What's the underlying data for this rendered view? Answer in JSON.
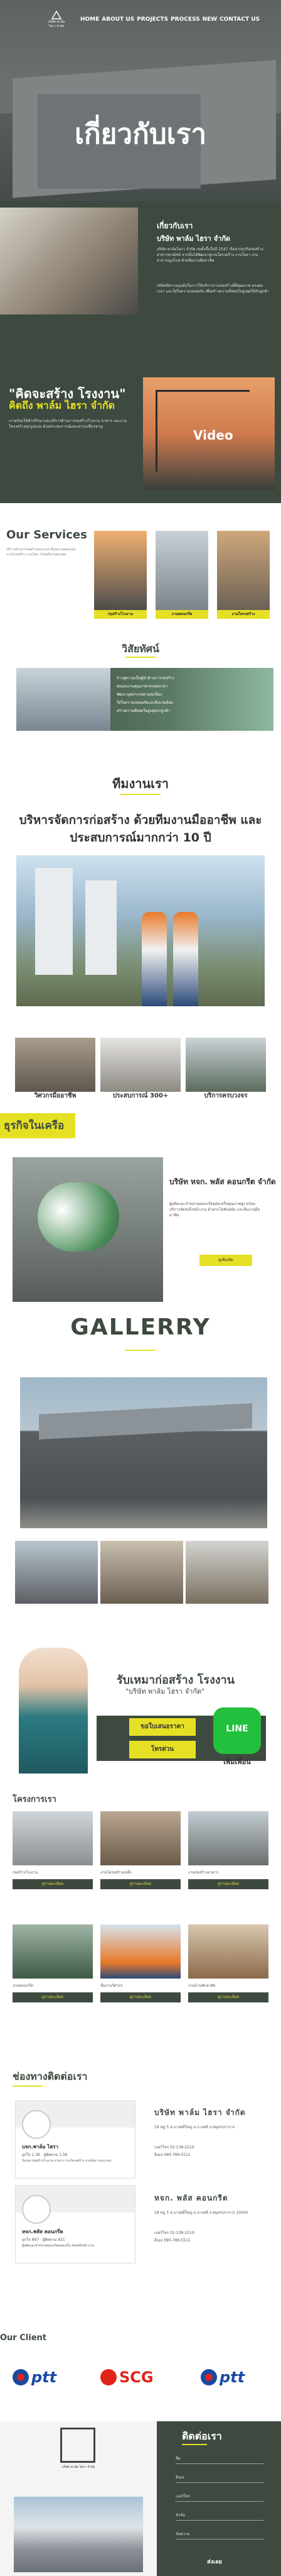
{
  "header": {
    "logo_line1": "บริษัท พาล์ม",
    "logo_line2": "ไฮรา จำกัด",
    "nav": [
      "HOME",
      "ABOUT US",
      "PROJECTS",
      "PROCESS",
      "NEW",
      "CONTACT US"
    ]
  },
  "hero": {
    "title": "เกี่ยวกับเรา"
  },
  "about": {
    "heading": "เกี่ยวกับเรา",
    "company": "บริษัท พาล์ม ไฮรา จำกัด",
    "para1": "บริษัท พาล์มไฮรา จำกัด ก่อตั้งขึ้นในปี 2547 เริ่มจากธุรกิจก่อสร้างอาคารพาณิชย์ จากนั้นได้พัฒนาสู่งานโครงสร้าง งานโยธา งานสาธารณูปโภค ด้วยทีมงานมืออาชีพ",
    "para2": "บริษัทมีความมุ่งมั่นในการให้บริการงานก่อสร้างที่มีคุณภาพ ตรงต่อเวลา และใส่ใจความปลอดภัย เพื่อสร้างความพึงพอใจสูงสุดให้กับลูกค้า",
    "quote1": "\"คิดจะสร้าง โรงงาน\"",
    "quote2": "คิดถึง พาล์ม ไฮรา จำกัด",
    "para3": "เราพร้อมให้คำปรึกษาและบริการด้านการก่อสร้างโรงงาน อาคาร และงานโครงสร้างทุกรูปแบบ ด้วยประสบการณ์และความเชี่ยวชาญ",
    "video_label": "Video"
  },
  "services": {
    "title": "Our Services",
    "desc": "บริการด้านการก่อสร้างครบวงจร ตั้งแต่งานออกแบบ งานโครงสร้าง งานโยธา ไปจนถึงงานตกแต่ง",
    "cards": [
      "ก่อสร้างโรงงาน",
      "งานคอนกรีต",
      "งานโครงสร้าง"
    ]
  },
  "vision": {
    "title": "วิสัยทัศน์",
    "items": [
      "ก้าวสู่ความเป็นผู้นำด้านการก่อสร้าง",
      "ส่งมอบงานคุณภาพ ตรงต่อเวลา",
      "พัฒนาบุคลากรอย่างต่อเนื่อง",
      "ใส่ใจความปลอดภัยและสิ่งแวดล้อม",
      "สร้างความพึงพอใจสูงสุดแก่ลูกค้า"
    ]
  },
  "team": {
    "heading": "ทีมงานเรา",
    "sub": "บริหารจัดการก่อสร้าง ด้วยทีมงานมืออาชีพ และประสบการณ์มากกว่า 10 ปี"
  },
  "three": [
    "วิศวกรมืออาชีพ",
    "ประสบการณ์ 300+",
    "บริการครบวงจร"
  ],
  "affiliate": {
    "heading": "ธุรกิจในเครือ",
    "title": "บริษัท หจก. พลัส คอนกรีต จำกัด",
    "para": "ผู้ผลิตและจำหน่ายคอนกรีตผสมเสร็จคุณภาพสูง พร้อมบริการจัดส่งถึงหน้างาน ด้วยรถโม่ทันสมัย และทีมงานมืออาชีพ",
    "button": "ดูเพิ่มเติม"
  },
  "gallery": {
    "title": "GALLERRY"
  },
  "banner": {
    "line1": "รับเหมาก่อสร้าง โรงงาน",
    "line2": "\"บริษัท พาล์ม ไฮรา จำกัด\"",
    "btn1": "ขอใบเสนอราคา",
    "btn2": "โทรด่วน",
    "line_label": "LINE",
    "line_caption": "เพิ่มเพื่อน"
  },
  "projects": {
    "title": "โครงการเรา",
    "cards": [
      {
        "caption": "ก่อสร้างโรงงาน",
        "button": "ดูรายละเอียด"
      },
      {
        "caption": "งานโครงสร้างเหล็ก",
        "button": "ดูรายละเอียด"
      },
      {
        "caption": "งานก่อสร้างอาคาร",
        "button": "ดูรายละเอียด"
      },
      {
        "caption": "งานคอนกรีต",
        "button": "ดูรายละเอียด"
      },
      {
        "caption": "ทีมงานวิศวกร",
        "button": "ดูรายละเอียด"
      },
      {
        "caption": "งานบ้านพักอาศัย",
        "button": "ดูรายละเอียด"
      }
    ]
  },
  "channel": {
    "title": "ช่องทางติดต่อเรา",
    "fb1": {
      "name": "บจก.พาล์ม ไฮรา",
      "stats": "ถูกใจ 1.2K · ผู้ติดตาม 1.5K",
      "desc": "รับเหมาก่อสร้างโรงงาน อาคาร งานโครงสร้าง งานโยธา ครบวงจร"
    },
    "fb2": {
      "name": "หจก.พลัส คอนกรีต",
      "stats": "ถูกใจ 867 · ผู้ติดตาม 921",
      "desc": "ผู้ผลิตและจำหน่ายคอนกรีตผสมเสร็จ จัดส่งถึงหน้างาน"
    },
    "co1": {
      "name": "บริษัท พาล์ม ไฮรา จำกัด",
      "addr": "18 หมู่ 5 ต.บางพลีใหญ่ อ.บางพลี จ.สมุทรปราการ",
      "tel": "เบอร์โทร 02-138-2219",
      "email": "อีเมล 090-789-5511"
    },
    "co2": {
      "name": "หจก. พลัส คอนกรีต",
      "addr": "18 หมู่ 5 ต.บางพลีใหญ่ อ.บางพลี จ.สมุทรปราการ 10540",
      "tel": "เบอร์โทร 02-138-2219",
      "email": "อีเมล 090-789-5511"
    }
  },
  "clients": {
    "title": "Our Client",
    "logos": [
      "ptt",
      "SCG",
      "ptt"
    ]
  },
  "footer": {
    "logo_text": "บริษัท พาล์ม ไฮรา จำกัด",
    "contact_title": "ติดต่อเรา",
    "fields": [
      "ชื่อ",
      "อีเมล",
      "เบอร์โทร",
      "หัวข้อ",
      "ข้อความ"
    ],
    "send": "ส่งเลย"
  },
  "colors": {
    "accent": "#e6e024",
    "dark_green": "#3e4a3f",
    "line_green": "#22c03c"
  }
}
